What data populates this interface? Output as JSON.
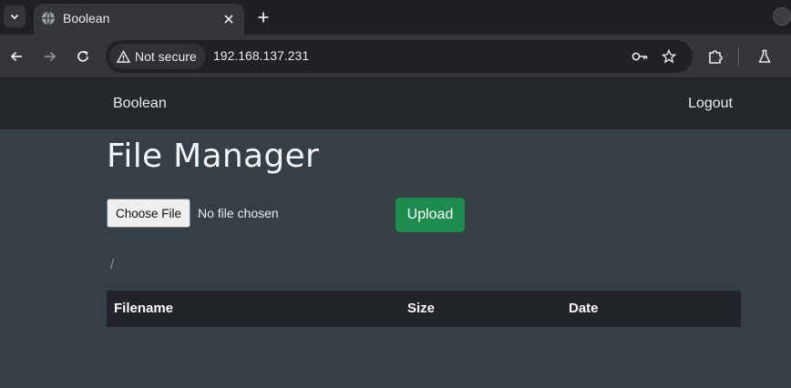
{
  "browser": {
    "tab": {
      "title": "Boolean",
      "favicon": "globe-icon"
    },
    "address_bar": {
      "security_label": "Not secure",
      "url": "192.168.137.231"
    },
    "icons": {
      "back": "arrow-left-icon",
      "forward": "arrow-right-icon",
      "reload": "reload-icon",
      "password": "key-icon",
      "bookmark": "star-icon",
      "extensions": "puzzle-icon",
      "labs": "flask-icon"
    }
  },
  "navbar": {
    "brand": "Boolean",
    "logout_label": "Logout"
  },
  "main": {
    "title": "File Manager",
    "file_input": {
      "button_label": "Choose File",
      "status": "No file chosen"
    },
    "upload_label": "Upload",
    "path": "/",
    "table": {
      "columns": [
        "Filename",
        "Size",
        "Date"
      ],
      "rows": []
    }
  },
  "colors": {
    "page_background": "#343f47",
    "navbar_background": "#24282b",
    "upload_button": "#1d8a4e",
    "table_header": "#212529"
  }
}
